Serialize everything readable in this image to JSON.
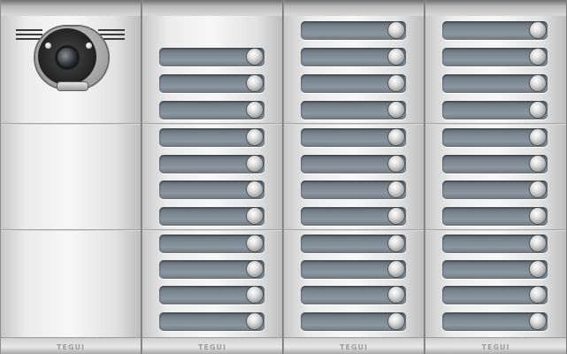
{
  "brand": "TEGUI",
  "panel": {
    "columns": 4,
    "modules_per_column": 3,
    "button_columns": 3,
    "buttons_per_column": 11
  }
}
